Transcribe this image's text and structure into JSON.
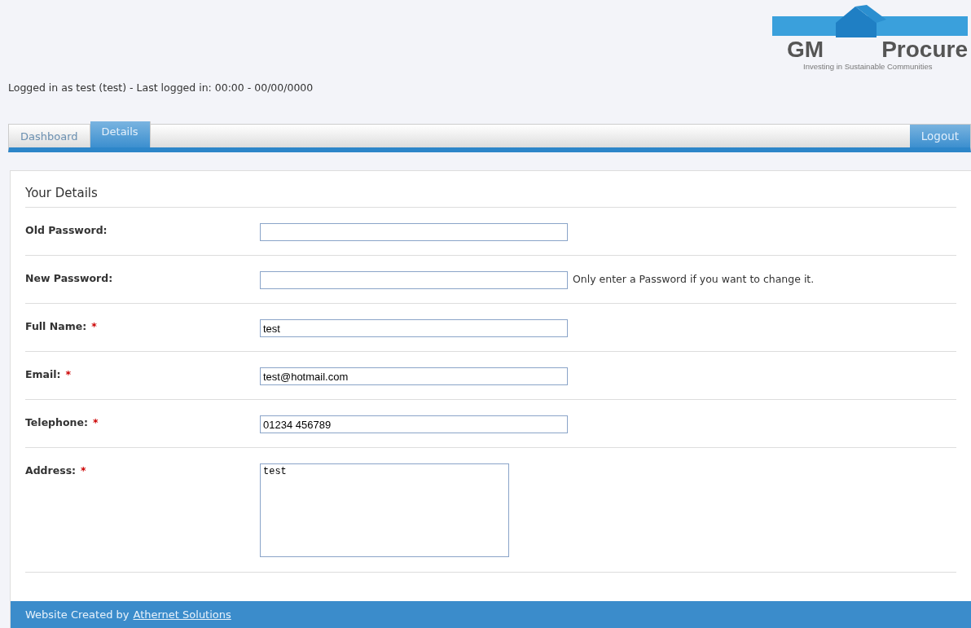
{
  "logo": {
    "brand_left": "GM",
    "brand_right": "Procure",
    "tagline": "Investing in Sustainable Communities"
  },
  "login_status": "Logged in as test (test) - Last logged in: 00:00 - 00/00/0000",
  "tabs": [
    {
      "label": "Dashboard",
      "selected": false
    },
    {
      "label": "Details",
      "selected": true
    }
  ],
  "logout_button": "Logout",
  "section_title": "Your Details",
  "fields": [
    {
      "label": "Old Password:",
      "required": false,
      "kind": "input"
    },
    {
      "label": "New Password:",
      "required": false,
      "kind": "input",
      "hint": "Only enter a Password if you want to change it."
    },
    {
      "label": "Full Name:",
      "required": true,
      "kind": "input",
      "value": "test"
    },
    {
      "label": "Email:",
      "required": true,
      "kind": "input",
      "value": "test@hotmail.com"
    },
    {
      "label": "Telephone:",
      "required": true,
      "kind": "input",
      "value": "01234 456789"
    },
    {
      "label": "Address:",
      "required": true,
      "kind": "textarea",
      "value": "test"
    }
  ],
  "required_mark": "*",
  "footer": {
    "text": "Website Created by",
    "link": "Athernet Solutions"
  }
}
